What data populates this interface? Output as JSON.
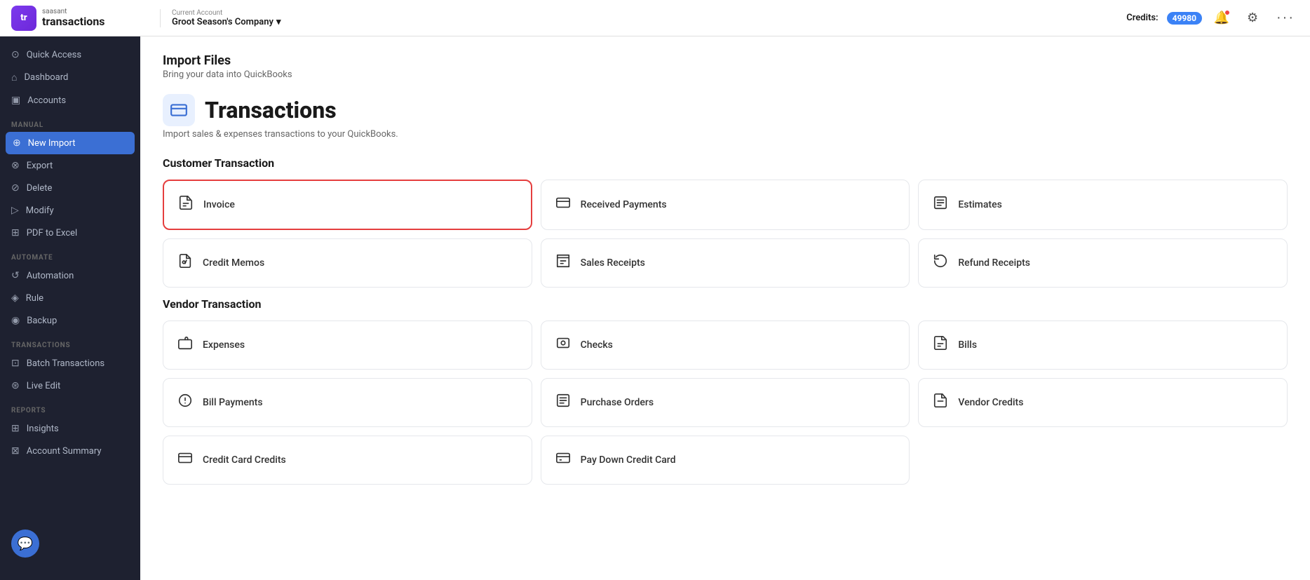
{
  "header": {
    "logo_top": "saasant",
    "logo_bottom": "transactions",
    "logo_abbr": "tr",
    "account_label": "Current Account",
    "account_name": "Groot Season's Company",
    "credits_label": "Credits:",
    "credits_value": "49980",
    "more_label": "···"
  },
  "sidebar": {
    "items_top": [
      {
        "id": "quick-access",
        "label": "Quick Access",
        "icon": "⊙"
      },
      {
        "id": "dashboard",
        "label": "Dashboard",
        "icon": "⌂"
      },
      {
        "id": "accounts",
        "label": "Accounts",
        "icon": "▣"
      }
    ],
    "section_manual": "MANUAL",
    "items_manual": [
      {
        "id": "new-import",
        "label": "New Import",
        "icon": "⊕",
        "active": true
      },
      {
        "id": "export",
        "label": "Export",
        "icon": "⊗"
      },
      {
        "id": "delete",
        "label": "Delete",
        "icon": "⊘"
      },
      {
        "id": "modify",
        "label": "Modify",
        "icon": "▷"
      },
      {
        "id": "pdf-to-excel",
        "label": "PDF to Excel",
        "icon": "⊞"
      }
    ],
    "section_automate": "AUTOMATE",
    "items_automate": [
      {
        "id": "automation",
        "label": "Automation",
        "icon": "↺"
      },
      {
        "id": "rule",
        "label": "Rule",
        "icon": "◈"
      },
      {
        "id": "backup",
        "label": "Backup",
        "icon": "◉"
      }
    ],
    "section_transactions": "TRANSACTIONS",
    "items_transactions": [
      {
        "id": "batch-transactions",
        "label": "Batch Transactions",
        "icon": "⊡"
      },
      {
        "id": "live-edit",
        "label": "Live Edit",
        "icon": "⊛"
      }
    ],
    "section_reports": "REPORTS",
    "items_reports": [
      {
        "id": "insights",
        "label": "Insights",
        "icon": "⊞"
      },
      {
        "id": "account-summary",
        "label": "Account Summary",
        "icon": "⊠"
      }
    ]
  },
  "main": {
    "import_title": "Import Files",
    "import_sub": "Bring your data into QuickBooks",
    "tx_title": "Transactions",
    "tx_subtitle": "Import sales & expenses transactions to your QuickBooks.",
    "customer_section": "Customer Transaction",
    "customer_cards": [
      {
        "id": "invoice",
        "label": "Invoice",
        "icon": "📋",
        "selected": true
      },
      {
        "id": "received-payments",
        "label": "Received Payments",
        "icon": "💳"
      },
      {
        "id": "estimates",
        "label": "Estimates",
        "icon": "📄"
      },
      {
        "id": "credit-memos",
        "label": "Credit Memos",
        "icon": "🧾"
      },
      {
        "id": "sales-receipts",
        "label": "Sales Receipts",
        "icon": "🎫"
      },
      {
        "id": "refund-receipts",
        "label": "Refund Receipts",
        "icon": "↩"
      }
    ],
    "vendor_section": "Vendor Transaction",
    "vendor_cards": [
      {
        "id": "expenses",
        "label": "Expenses",
        "icon": "💰"
      },
      {
        "id": "checks",
        "label": "Checks",
        "icon": "🔲"
      },
      {
        "id": "bills",
        "label": "Bills",
        "icon": "📑"
      },
      {
        "id": "bill-payments",
        "label": "Bill Payments",
        "icon": "💲"
      },
      {
        "id": "purchase-orders",
        "label": "Purchase Orders",
        "icon": "📋"
      },
      {
        "id": "vendor-credits",
        "label": "Vendor Credits",
        "icon": "📄"
      },
      {
        "id": "credit-card-credits",
        "label": "Credit Card Credits",
        "icon": "💳"
      },
      {
        "id": "pay-down-credit-card",
        "label": "Pay Down Credit Card",
        "icon": "💳"
      }
    ]
  }
}
